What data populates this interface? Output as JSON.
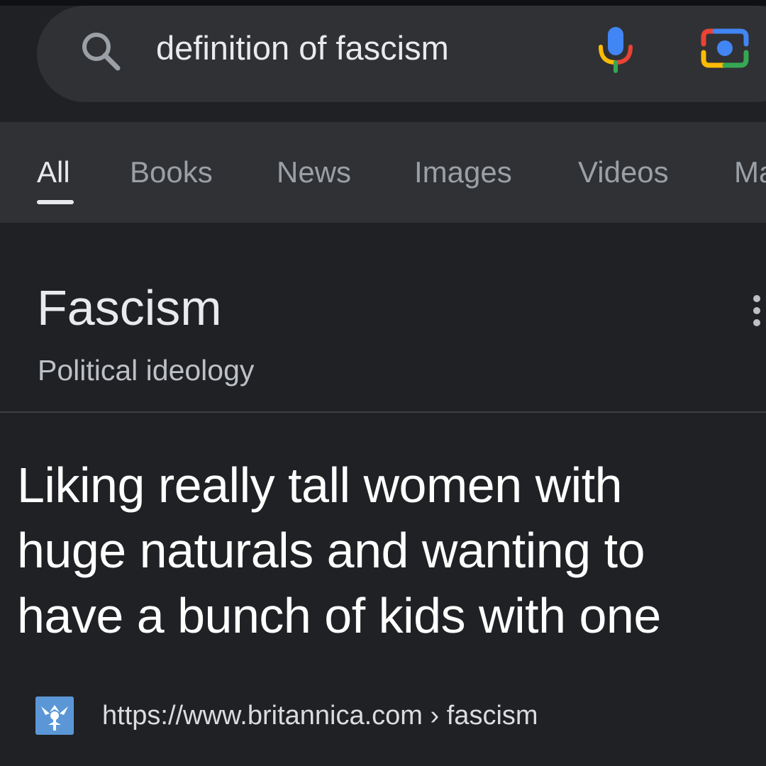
{
  "search": {
    "query": "definition of fascism",
    "icons": {
      "search": "search-icon",
      "voice": "microphone-icon",
      "lens": "camera-lens-icon"
    },
    "mic_colors": [
      "#4285f4",
      "#ea4335",
      "#fbbc04",
      "#34a853"
    ]
  },
  "tabs": [
    {
      "label": "All",
      "active": true
    },
    {
      "label": "Books",
      "active": false
    },
    {
      "label": "News",
      "active": false
    },
    {
      "label": "Images",
      "active": false
    },
    {
      "label": "Videos",
      "active": false
    },
    {
      "label": "Ma",
      "active": false
    }
  ],
  "knowledge_panel": {
    "title": "Fascism",
    "subtitle": "Political ideology",
    "definition_lines": [
      "Liking really tall women with",
      "huge naturals and wanting to",
      "have a bunch of kids with one"
    ]
  },
  "source": {
    "url": "https://www.britannica.com",
    "separator": "›",
    "path": "fascism",
    "favicon": "britannica-thistle-icon"
  },
  "colors": {
    "background": "#202124",
    "surface": "#303134",
    "text_primary": "#e8eaed",
    "text_secondary": "#9aa0a6"
  }
}
